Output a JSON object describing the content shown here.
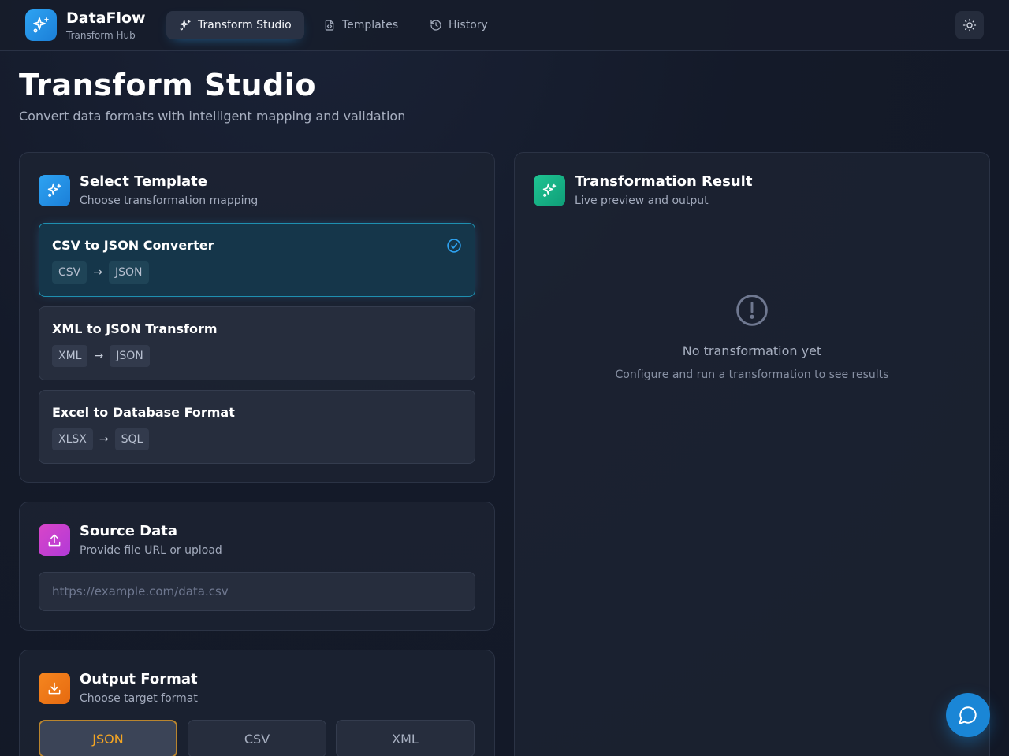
{
  "brand": {
    "name": "DataFlow",
    "subtitle": "Transform Hub"
  },
  "nav": {
    "items": [
      {
        "label": "Transform Studio",
        "icon": "sparkles-icon",
        "active": true
      },
      {
        "label": "Templates",
        "icon": "file-code-icon",
        "active": false
      },
      {
        "label": "History",
        "icon": "history-icon",
        "active": false
      }
    ]
  },
  "header": {
    "theme_toggle_icon": "sun-icon"
  },
  "page": {
    "title": "Transform Studio",
    "subtitle": "Convert data formats with intelligent mapping and validation"
  },
  "template_card": {
    "title": "Select Template",
    "subtitle": "Choose transformation mapping",
    "templates": [
      {
        "name": "CSV to JSON Converter",
        "from": "CSV",
        "to": "JSON",
        "selected": true
      },
      {
        "name": "XML to JSON Transform",
        "from": "XML",
        "to": "JSON",
        "selected": false
      },
      {
        "name": "Excel to Database Format",
        "from": "XLSX",
        "to": "SQL",
        "selected": false
      }
    ],
    "arrow": "→"
  },
  "source_card": {
    "title": "Source Data",
    "subtitle": "Provide file URL or upload",
    "input_placeholder": "https://example.com/data.csv",
    "input_value": ""
  },
  "output_card": {
    "title": "Output Format",
    "subtitle": "Choose target format",
    "formats": [
      {
        "label": "JSON",
        "selected": true
      },
      {
        "label": "CSV",
        "selected": false
      },
      {
        "label": "XML",
        "selected": false
      }
    ]
  },
  "result_card": {
    "title": "Transformation Result",
    "subtitle": "Live preview and output",
    "empty_title": "No transformation yet",
    "empty_subtitle": "Configure and run a transformation to see results"
  },
  "colors": {
    "accent_blue": "#2ea3f2",
    "accent_green": "#16b48a",
    "accent_pink": "#d845c8",
    "accent_orange": "#f5861f",
    "selected_format": "#f5a623"
  }
}
